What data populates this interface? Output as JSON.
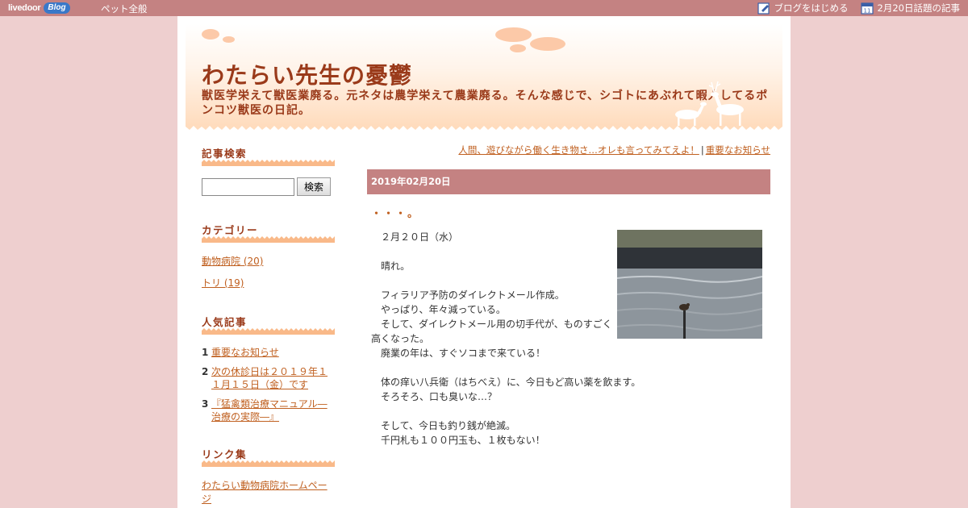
{
  "topbar": {
    "logo_text": "livedoor",
    "logo_badge": "Blog",
    "category": "ペット全般",
    "start_blog": "ブログをはじめる",
    "topic_articles": "2月20日話題の記事"
  },
  "header": {
    "title": "わたらい先生の憂鬱",
    "description": "獣医学栄えて獣医業廃る。元ネタは農学栄えて農業廃る。そんな感じで、シゴトにあぶれて暇人してるポンコツ獣医の日記。"
  },
  "sidebar": {
    "search": {
      "heading": "記事検索",
      "button": "検索",
      "value": ""
    },
    "categories": {
      "heading": "カテゴリー",
      "items": [
        "動物病院 (20)",
        "トリ (19)"
      ]
    },
    "popular": {
      "heading": "人気記事",
      "items": [
        {
          "num": "1",
          "label": "重要なお知らせ"
        },
        {
          "num": "2",
          "label": "次の休診日は２０１９年１１月１５日（金）です"
        },
        {
          "num": "3",
          "label": "『猛禽類治療マニュアル―治療の実際―』"
        }
      ]
    },
    "links": {
      "heading": "リンク集",
      "items": [
        "わたらい動物病院ホームページ"
      ]
    }
  },
  "main": {
    "nav": {
      "prev": "人間、遊びながら働く生き物さ…オレも言ってみてえよ！",
      "separator": "|",
      "next": "重要なお知らせ"
    },
    "date": "2019年02月20日",
    "post": {
      "title": "・・・。",
      "lines": [
        "　２月２０日（水）",
        "",
        "　晴れ。",
        "",
        "　フィラリア予防のダイレクトメール作成。",
        "　やっぱり、年々減っている。",
        "　そして、ダイレクトメール用の切手代が、ものすごく高くなった。",
        "　廃業の年は、すぐソコまで来ている！",
        "",
        "　体の痒い八兵衛（はちべえ）に、今日もど高い薬を飲ます。",
        "　そろそろ、口も臭いな…？",
        "",
        "　そして、今日も釣り銭が絶滅。",
        "　千円札も１００円玉も、１枚もない！"
      ]
    }
  },
  "colors": {
    "topbar": "#c48282",
    "background": "#eecfcf",
    "accent_text": "#9a3a1a",
    "link": "#c06020"
  }
}
